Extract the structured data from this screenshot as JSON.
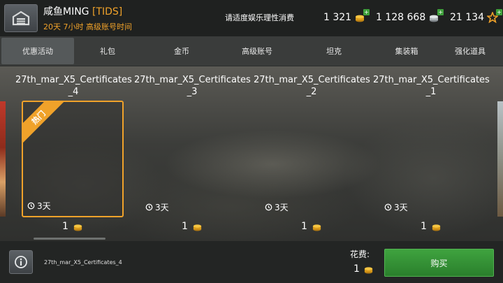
{
  "header": {
    "player_name": "咸鱼MING",
    "clan_tag": "[TIDS]",
    "premium_time": "20天 7小时 高级账号时间",
    "notice": "请适度娱乐理性消费",
    "credits": "1 321",
    "silver": "1 128 668",
    "experience": "21 134"
  },
  "tabs": [
    {
      "label": "优惠活动",
      "active": true
    },
    {
      "label": "礼包"
    },
    {
      "label": "金币"
    },
    {
      "label": "高级账号"
    },
    {
      "label": "坦克"
    },
    {
      "label": "集装箱"
    },
    {
      "label": "强化道具"
    }
  ],
  "cards": [
    {
      "title_line1": "27th_mar_X5_Certificates",
      "title_line2": "_4",
      "duration": "3天",
      "price": "1",
      "badge": "热门"
    },
    {
      "title_line1": "27th_mar_X5_Certificates",
      "title_line2": "_3",
      "duration": "3天",
      "price": "1"
    },
    {
      "title_line1": "27th_mar_X5_Certificates",
      "title_line2": "_2",
      "duration": "3天",
      "price": "1"
    },
    {
      "title_line1": "27th_mar_X5_Certificates",
      "title_line2": "_1",
      "duration": "3天",
      "price": "1"
    }
  ],
  "footer": {
    "selected_item": "27th_mar_X5_Certificates_4",
    "cost_label": "花费:",
    "cost_value": "1",
    "buy_label": "购买"
  },
  "colors": {
    "accent": "#f0a22a",
    "buy_green": "#2f8f31",
    "topbar": "#1f2120",
    "tabbar": "#3a3c3b"
  },
  "icons": [
    "garage-icon",
    "gold-coin-icon",
    "silver-coin-icon",
    "star-xp-icon",
    "plus-icon",
    "clock-icon",
    "info-icon"
  ]
}
